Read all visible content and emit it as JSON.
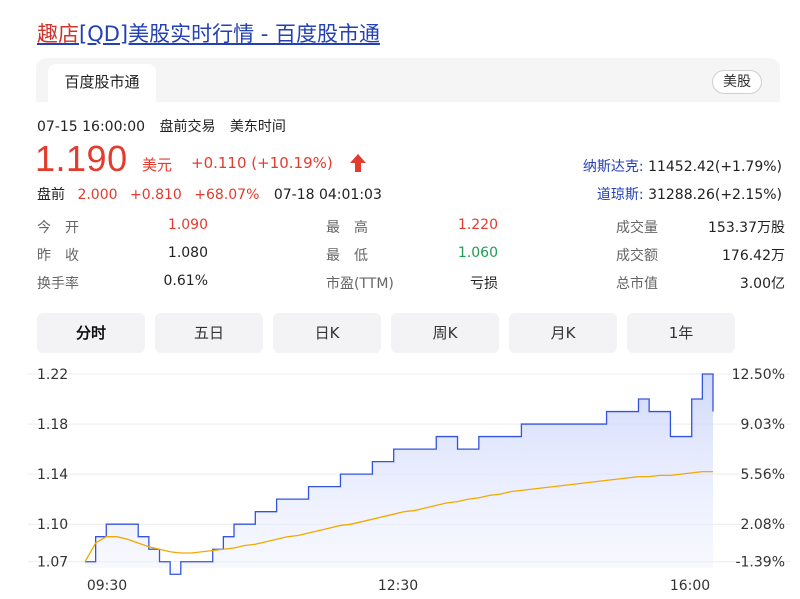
{
  "header": {
    "title_prefix": "趣店",
    "title_rest": "[QD]美股实时行情 - 百度股市通"
  },
  "tabs": {
    "active_label": "百度股市通",
    "market_tag": "美股"
  },
  "quote": {
    "timestamp": "07-15 16:00:00",
    "session": "盘前交易",
    "timezone": "美东时间",
    "price": "1.190",
    "currency": "美元",
    "change": "+0.110 (+10.19%)",
    "premarket_label": "盘前",
    "premarket_price": "2.000",
    "premarket_change": "+0.810",
    "premarket_pct": "+68.07%",
    "premarket_time": "07-18 04:01:03"
  },
  "indices": [
    {
      "name": "纳斯达克:",
      "value": "11452.42(+1.79%)"
    },
    {
      "name": "道琼斯:",
      "value": "31288.26(+2.15%)"
    }
  ],
  "stats": {
    "open_label": "今　开",
    "open": "1.090",
    "prev_label": "昨　收",
    "prev": "1.080",
    "turnover_label": "换手率",
    "turnover": "0.61%",
    "high_label": "最　高",
    "high": "1.220",
    "low_label": "最　低",
    "low": "1.060",
    "pe_label": "市盈(TTM)",
    "pe": "亏损",
    "volume_label": "成交量",
    "volume": "153.37万股",
    "amount_label": "成交额",
    "amount": "176.42万",
    "mktcap_label": "总市值",
    "mktcap": "3.00亿"
  },
  "periods": [
    "分时",
    "五日",
    "日K",
    "周K",
    "月K",
    "1年"
  ],
  "colors": {
    "price_up": "#e33b2e",
    "price_down": "#1f9d55",
    "link": "#2440b3",
    "line": "#3355dd",
    "avg": "#f2a900"
  },
  "chart_data": {
    "type": "line",
    "y_ticks_left": [
      "1.22",
      "1.18",
      "1.14",
      "1.10",
      "1.07"
    ],
    "y_ticks_right": [
      "12.50%",
      "9.03%",
      "5.56%",
      "2.08%",
      "-1.39%"
    ],
    "x_ticks": [
      "09:30",
      "12:30",
      "16:00"
    ],
    "ylim": [
      1.065,
      1.22
    ],
    "series": [
      {
        "values": [
          1.07,
          1.09,
          1.1,
          1.1,
          1.1,
          1.09,
          1.08,
          1.07,
          1.06,
          1.07,
          1.07,
          1.07,
          1.08,
          1.09,
          1.1,
          1.1,
          1.11,
          1.11,
          1.12,
          1.12,
          1.12,
          1.13,
          1.13,
          1.13,
          1.14,
          1.14,
          1.14,
          1.15,
          1.15,
          1.16,
          1.16,
          1.16,
          1.16,
          1.17,
          1.17,
          1.16,
          1.16,
          1.17,
          1.17,
          1.17,
          1.17,
          1.18,
          1.18,
          1.18,
          1.18,
          1.18,
          1.18,
          1.18,
          1.18,
          1.19,
          1.19,
          1.19,
          1.2,
          1.19,
          1.19,
          1.17,
          1.17,
          1.2,
          1.22,
          1.19
        ]
      },
      {
        "values": [
          1.07,
          1.085,
          1.09,
          1.09,
          1.088,
          1.085,
          1.082,
          1.08,
          1.078,
          1.077,
          1.077,
          1.078,
          1.079,
          1.08,
          1.081,
          1.083,
          1.084,
          1.086,
          1.088,
          1.09,
          1.091,
          1.093,
          1.095,
          1.097,
          1.099,
          1.1,
          1.102,
          1.104,
          1.106,
          1.108,
          1.11,
          1.111,
          1.113,
          1.115,
          1.117,
          1.118,
          1.12,
          1.121,
          1.123,
          1.124,
          1.126,
          1.127,
          1.128,
          1.129,
          1.13,
          1.131,
          1.132,
          1.133,
          1.134,
          1.135,
          1.136,
          1.137,
          1.138,
          1.138,
          1.139,
          1.139,
          1.14,
          1.141,
          1.142,
          1.142
        ]
      }
    ]
  }
}
